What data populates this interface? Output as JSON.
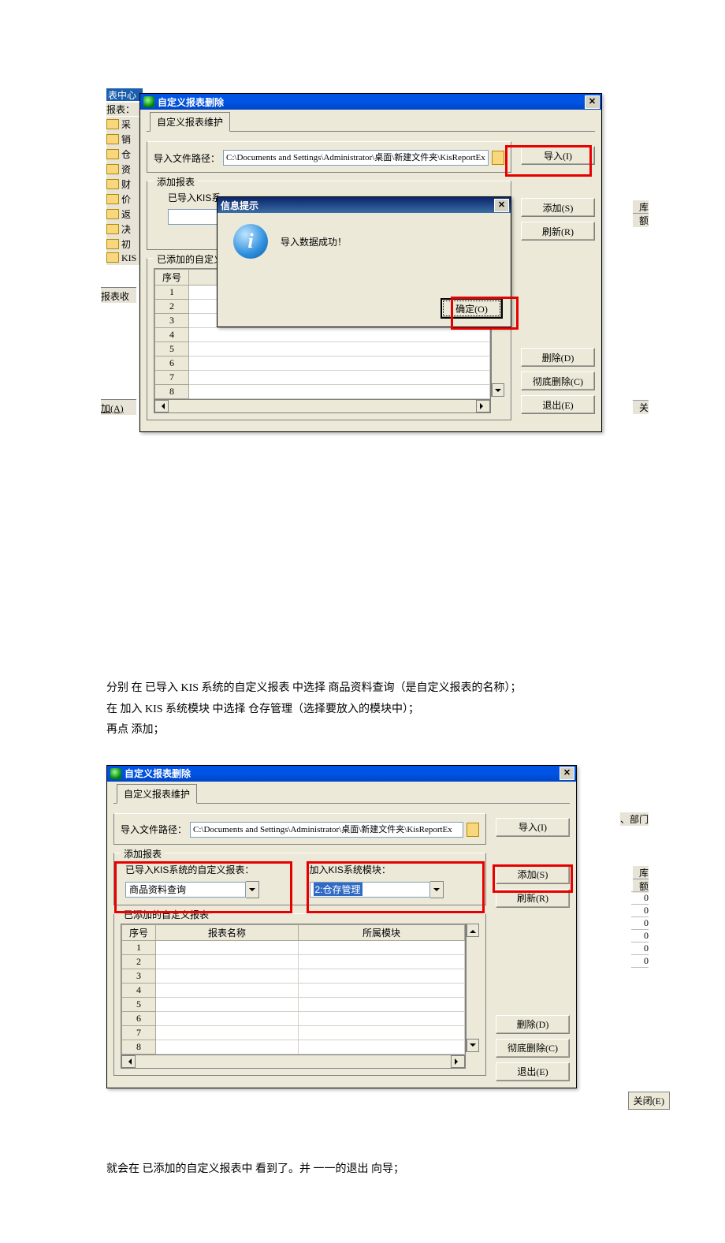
{
  "screenshot1": {
    "bg_title_frag": "表中心",
    "bg_left_label": "报表：",
    "tree": [
      "采",
      "销",
      "仓",
      "资",
      "财",
      "价",
      "返",
      "决",
      "初",
      "KIS"
    ],
    "bg_lbl_fav": "报表收",
    "bg_lbl_add": "加(A)",
    "win_title": "自定义报表删除",
    "tab": "自定义报表维护",
    "path_label": "导入文件路径：",
    "path_value": "C:\\Documents and Settings\\Administrator\\桌面\\新建文件夹\\KisReportEx",
    "btn_import": "导入(I)",
    "group_add": "添加报表",
    "lbl_imported": "已导入KIS系",
    "btn_add": "添加(S)",
    "btn_refresh": "刷新(R)",
    "group_added": "已添加的自定义",
    "col_seq": "序号",
    "rows": [
      "1",
      "2",
      "3",
      "4",
      "5",
      "6",
      "7",
      "8"
    ],
    "btn_delete": "删除(D)",
    "btn_harddel": "彻底删除(C)",
    "btn_exit": "退出(E)",
    "msg_title": "信息提示",
    "msg_text": "导入数据成功！",
    "msg_ok": "确定(O)",
    "bg_r1": "库",
    "bg_r2": "额",
    "bg_r3": "关"
  },
  "para1": {
    "l1": "分别 在 已导入 KIS 系统的自定义报表 中选择 商品资料查询（是自定义报表的名称）；",
    "l2": "在 加入 KIS 系统模块 中选择 仓存管理（选择要放入的模块中）；",
    "l3": "再点 添加；"
  },
  "screenshot2": {
    "win_title": "自定义报表删除",
    "tab": "自定义报表维护",
    "path_label": "导入文件路径：",
    "path_value": "C:\\Documents and Settings\\Administrator\\桌面\\新建文件夹\\KisReportEx",
    "btn_import": "导入(I)",
    "group_add": "添加报表",
    "lbl_imported": "已导入KIS系统的自定义报表：",
    "dd_value": "商品资料查询",
    "lbl_module": "加入KIS系统模块：",
    "dd_module": "2:仓存管理",
    "btn_add": "添加(S)",
    "btn_refresh": "刷新(R)",
    "group_added": "已添加的自定义报表",
    "col_seq": "序号",
    "col_name": "报表名称",
    "col_mod": "所属模块",
    "rows": [
      "1",
      "2",
      "3",
      "4",
      "5",
      "6",
      "7",
      "8"
    ],
    "btn_delete": "删除(D)",
    "btn_harddel": "彻底删除(C)",
    "btn_exit": "退出(E)",
    "bg_r0": "、部门",
    "bg_r1": "库",
    "bg_r2": "额",
    "bg_zeros": [
      "0",
      "0",
      "0",
      "0",
      "0",
      "0"
    ],
    "bg_close": "关闭(E)"
  },
  "para2": "就会在 已添加的自定义报表中 看到了。并 一一的退出 向导；"
}
